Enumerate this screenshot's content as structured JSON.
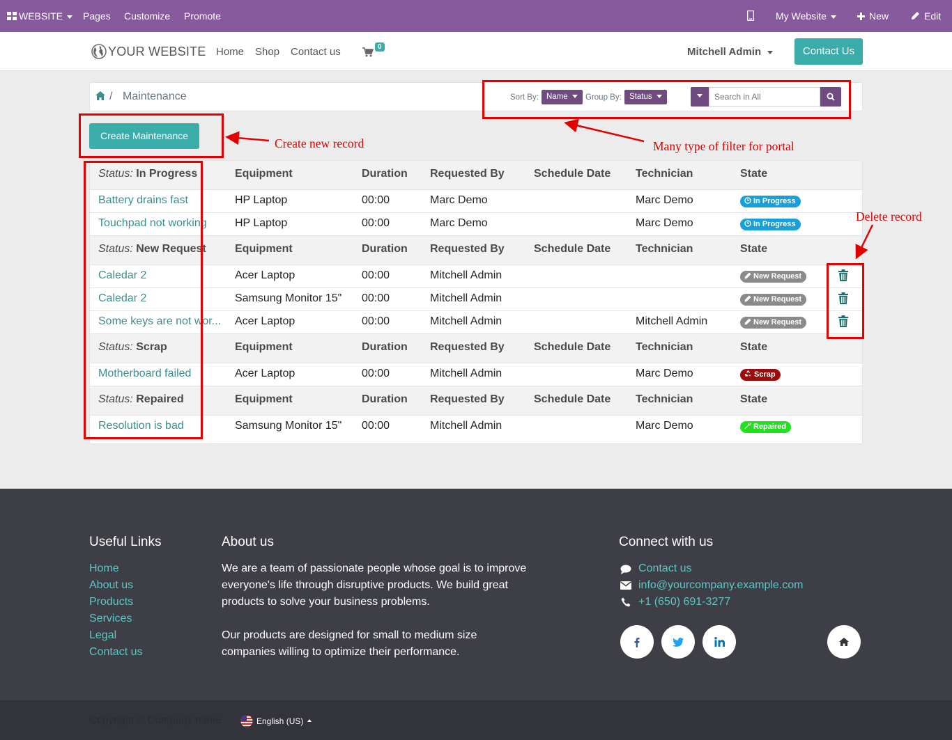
{
  "admin_bar": {
    "app_label": "WEBSITE",
    "menu": [
      "Pages",
      "Customize",
      "Promote"
    ],
    "website_selector": "My Website",
    "new_label": "New",
    "edit_label": "Edit"
  },
  "header": {
    "logo_text": "YOUR WEBSITE",
    "nav": [
      "Home",
      "Shop",
      "Contact us"
    ],
    "cart_count": "0",
    "user_name": "Mitchell Admin",
    "contact_button": "Contact Us"
  },
  "breadcrumb": {
    "separator": "/",
    "current": "Maintenance"
  },
  "filters": {
    "sort_label": "Sort By:",
    "sort_value": "Name",
    "group_label": "Group By:",
    "group_value": "Status",
    "search_placeholder": "Search in All"
  },
  "create_button": "Create Maintenance",
  "columns": [
    "Equipment",
    "Duration",
    "Requested By",
    "Schedule Date",
    "Technician",
    "State"
  ],
  "status_prefix": "Status:",
  "groups": [
    {
      "status": "In Progress",
      "rows": [
        {
          "name": "Battery drains fast",
          "equipment": "HP Laptop",
          "duration": "00:00",
          "requested_by": "Marc Demo",
          "schedule_date": "",
          "technician": "Marc Demo",
          "state": "In Progress",
          "deletable": false
        },
        {
          "name": "Touchpad not working",
          "equipment": "HP Laptop",
          "duration": "00:00",
          "requested_by": "Marc Demo",
          "schedule_date": "",
          "technician": "Marc Demo",
          "state": "In Progress",
          "deletable": false
        }
      ]
    },
    {
      "status": "New Request",
      "rows": [
        {
          "name": "Caledar 2",
          "equipment": "Acer Laptop",
          "duration": "00:00",
          "requested_by": "Mitchell Admin",
          "schedule_date": "",
          "technician": "",
          "state": "New Request",
          "deletable": true
        },
        {
          "name": "Caledar 2",
          "equipment": "Samsung Monitor 15\"",
          "duration": "00:00",
          "requested_by": "Mitchell Admin",
          "schedule_date": "",
          "technician": "",
          "state": "New Request",
          "deletable": true
        },
        {
          "name": "Some keys are not wor...",
          "equipment": "Acer Laptop",
          "duration": "00:00",
          "requested_by": "Mitchell Admin",
          "schedule_date": "",
          "technician": "Mitchell Admin",
          "state": "New Request",
          "deletable": true
        }
      ]
    },
    {
      "status": "Scrap",
      "rows": [
        {
          "name": "Motherboard failed",
          "equipment": "Acer Laptop",
          "duration": "00:00",
          "requested_by": "Mitchell Admin",
          "schedule_date": "",
          "technician": "Marc Demo",
          "state": "Scrap",
          "deletable": false
        }
      ]
    },
    {
      "status": "Repaired",
      "rows": [
        {
          "name": "Resolution is bad",
          "equipment": "Samsung Monitor 15\"",
          "duration": "00:00",
          "requested_by": "Mitchell Admin",
          "schedule_date": "",
          "technician": "Marc Demo",
          "state": "Repaired",
          "deletable": false
        }
      ]
    }
  ],
  "state_colors": {
    "In Progress": "#1a9fd8",
    "New Request": "#8a8a8a",
    "Scrap": "#9b0d0d",
    "Repaired": "#22e01f"
  },
  "state_icons": {
    "In Progress": "clock-icon",
    "New Request": "pencil-icon",
    "Scrap": "recycle-icon",
    "Repaired": "wrench-icon"
  },
  "annotations": {
    "create": "Create new record",
    "filters": "Many type of filter for portal",
    "delete": "Delete record"
  },
  "footer": {
    "useful_links_title": "Useful Links",
    "useful_links": [
      "Home",
      "About us",
      "Products",
      "Services",
      "Legal",
      "Contact us"
    ],
    "about_title": "About us",
    "about_p1": "We are a team of passionate people whose goal is to improve everyone's life through disruptive products. We build great products to solve your business problems.",
    "about_p2": "Our products are designed for small to medium size companies willing to optimize their performance.",
    "connect_title": "Connect with us",
    "contact_link": "Contact us",
    "email": "info@yourcompany.example.com",
    "phone": "+1 (650) 691-3277",
    "social": [
      "facebook-icon",
      "twitter-icon",
      "linkedin-icon",
      "home-icon"
    ]
  },
  "bottom": {
    "copyright": "Copyright © Company name",
    "language": "English (US)"
  },
  "colors": {
    "admin_bar": "#875a9e",
    "primary": "#3aadaa",
    "filter_button": "#6f4b7f",
    "annotation": "#e30000",
    "footer": "#3d3e46"
  }
}
